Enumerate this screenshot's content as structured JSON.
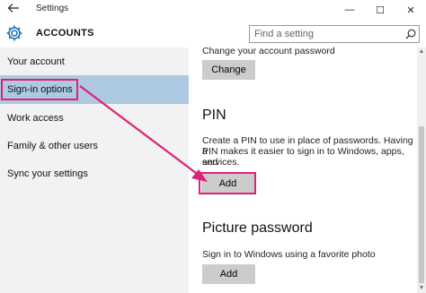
{
  "titlebar": {
    "app_title": "Settings",
    "back_icon": "back-arrow-icon",
    "minimize": "—",
    "maximize": "☐",
    "close": "✕"
  },
  "header": {
    "section_title": "ACCOUNTS",
    "section_icon": "gear-icon",
    "search_placeholder": "Find a setting"
  },
  "sidebar": {
    "items": [
      {
        "label": "Your account",
        "selected": false
      },
      {
        "label": "Sign-in options",
        "selected": true
      },
      {
        "label": "Work access",
        "selected": false
      },
      {
        "label": "Family & other users",
        "selected": false
      },
      {
        "label": "Sync your settings",
        "selected": false
      }
    ]
  },
  "main": {
    "password": {
      "description": "Change your account password",
      "button": "Change"
    },
    "pin": {
      "heading": "PIN",
      "description_lines": [
        "Create a PIN to use in place of passwords. Having a",
        "PIN makes it easier to sign in to Windows, apps, and",
        "services."
      ],
      "button": "Add"
    },
    "picture_password": {
      "heading": "Picture password",
      "description": "Sign in to Windows using a favorite photo",
      "button": "Add"
    }
  },
  "colors": {
    "selected_nav": "#aec9e2",
    "annotation": "#e0207a",
    "sidebar_bg": "#f2f2f2",
    "button_bg": "#cccccc"
  }
}
